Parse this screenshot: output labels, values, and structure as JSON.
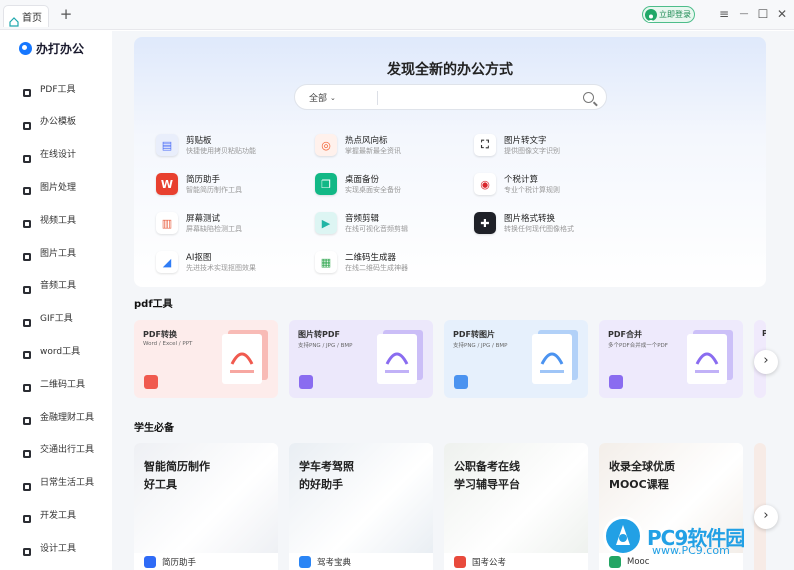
{
  "titlebar": {
    "tab_label": "首页",
    "add_tab": "+",
    "login_label": "立即登录",
    "menu_icon": "≡",
    "minimize_icon": "—",
    "maximize_icon": "☐",
    "close_icon": "✕"
  },
  "sidebar": {
    "logo_text": "办打办公",
    "items": [
      {
        "label": "PDF工具",
        "icon": "pdf-icon"
      },
      {
        "label": "办公模板",
        "icon": "template-icon"
      },
      {
        "label": "在线设计",
        "icon": "design-icon"
      },
      {
        "label": "图片处理",
        "icon": "image-process-icon"
      },
      {
        "label": "视频工具",
        "icon": "video-icon"
      },
      {
        "label": "图片工具",
        "icon": "image-icon"
      },
      {
        "label": "音频工具",
        "icon": "audio-icon"
      },
      {
        "label": "GIF工具",
        "icon": "gif-icon"
      },
      {
        "label": "word工具",
        "icon": "word-icon"
      },
      {
        "label": "二维码工具",
        "icon": "qrcode-icon"
      },
      {
        "label": "金融理财工具",
        "icon": "finance-icon"
      },
      {
        "label": "交通出行工具",
        "icon": "traffic-icon"
      },
      {
        "label": "日常生活工具",
        "icon": "daily-icon"
      },
      {
        "label": "开发工具",
        "icon": "dev-icon"
      },
      {
        "label": "设计工具",
        "icon": "design-tool-icon"
      }
    ]
  },
  "hero": {
    "title": "发现全新的办公方式",
    "search_category": "全部",
    "search_placeholder": ""
  },
  "tools": [
    {
      "name": "剪贴板",
      "desc": "快捷使用拷贝粘贴功能",
      "color": "#e9eefb",
      "glyph": "▤",
      "glyph_color": "#4a6cf7"
    },
    {
      "name": "热点风向标",
      "desc": "掌握最新最全资讯",
      "color": "#fff1ec",
      "glyph": "◎",
      "glyph_color": "#f25b2a"
    },
    {
      "name": "图片转文字",
      "desc": "提供图像文字识别",
      "color": "#ffffff",
      "glyph": "⛶",
      "glyph_color": "#333333"
    },
    {
      "name": "简历助手",
      "desc": "智能简历制作工具",
      "color": "#e8402f",
      "glyph": "W",
      "glyph_color": "#ffffff"
    },
    {
      "name": "桌面备份",
      "desc": "实现桌面安全备份",
      "color": "#12b886",
      "glyph": "❐",
      "glyph_color": "#ffffff"
    },
    {
      "name": "个税计算",
      "desc": "专业个税计算规则",
      "color": "#ffffff",
      "glyph": "◉",
      "glyph_color": "#d9262c"
    },
    {
      "name": "屏幕测试",
      "desc": "屏幕缺陷检测工具",
      "color": "#ffffff",
      "glyph": "▥",
      "glyph_color": "#e85d3f"
    },
    {
      "name": "音频剪辑",
      "desc": "在线可视化音频剪辑",
      "color": "#ddf5f3",
      "glyph": "▶",
      "glyph_color": "#21b5a5"
    },
    {
      "name": "图片格式转换",
      "desc": "转换任何现代图像格式",
      "color": "#1f2128",
      "glyph": "✚",
      "glyph_color": "#ffffff"
    },
    {
      "name": "AI抠图",
      "desc": "先进技术实现抠图效果",
      "color": "#ffffff",
      "glyph": "◢",
      "glyph_color": "#2f7df6"
    },
    {
      "name": "二维码生成器",
      "desc": "在线二维码生成神器",
      "color": "#ffffff",
      "glyph": "▦",
      "glyph_color": "#34a853"
    }
  ],
  "pdf_section": {
    "title": "pdf工具",
    "cards": [
      {
        "title": "PDF转换",
        "sub": "Word / Excel / PPT",
        "bg": "#fdeceb",
        "accent": "#f05a4f"
      },
      {
        "title": "图片转PDF",
        "sub": "支持PNG / JPG / BMP",
        "bg": "#ece8fb",
        "accent": "#8a6cf0"
      },
      {
        "title": "PDF转图片",
        "sub": "支持PNG / JPG / BMP",
        "bg": "#e6f0fc",
        "accent": "#4b93f0"
      },
      {
        "title": "PDF合并",
        "sub": "多个PDF合并成一个PDF",
        "bg": "#eeeafc",
        "accent": "#8a6cf0"
      }
    ],
    "partial_card_title": "P"
  },
  "student_section": {
    "title": "学生必备",
    "cards": [
      {
        "title": "智能简历制作\n好工具",
        "footer": "简历助手",
        "img_color": "#eef0f4",
        "icon_color": "#2f6bf6"
      },
      {
        "title": "学车考驾照\n的好助手",
        "footer": "驾考宝典",
        "img_color": "#e9eef3",
        "icon_color": "#2a85f5"
      },
      {
        "title": "公职备考在线\n学习辅导平台",
        "footer": "国考公考",
        "img_color": "#eef1ee",
        "icon_color": "#e84a3c"
      },
      {
        "title": "收录全球优质\nMOOC课程",
        "footer": "Mooc",
        "img_color": "#f3eee9",
        "icon_color": "#23a564"
      }
    ]
  },
  "watermark": {
    "text": "PC9软件园",
    "url": "www.PC9.com"
  }
}
